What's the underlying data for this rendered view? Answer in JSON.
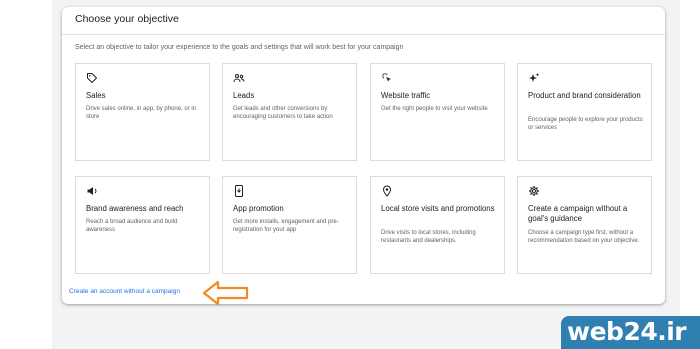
{
  "dialog": {
    "title": "Choose your objective",
    "subtitle": "Select an objective to tailor your experience to the goals and settings that will work best for your campaign"
  },
  "objectives": [
    {
      "icon": "tag-icon",
      "title": "Sales",
      "desc": "Drive sales online, in app, by phone, or in store"
    },
    {
      "icon": "people-icon",
      "title": "Leads",
      "desc": "Get leads and other conversions by encouraging customers to take action"
    },
    {
      "icon": "cursor-click-icon",
      "title": "Website traffic",
      "desc": "Get the right people to visit your website"
    },
    {
      "icon": "sparkle-icon",
      "title": "Product and brand consideration",
      "desc": "Encourage people to explore your products or services"
    },
    {
      "icon": "megaphone-icon",
      "title": "Brand awareness and reach",
      "desc": "Reach a broad audience and build awareness"
    },
    {
      "icon": "phone-icon",
      "title": "App promotion",
      "desc": "Get more installs, engagement and pre-registration for your app"
    },
    {
      "icon": "location-pin-icon",
      "title": "Local store visits and promotions",
      "desc": "Drive visits to local stores, including restaurants and dealerships."
    },
    {
      "icon": "gear-icon",
      "title": "Create a campaign without a goal's guidance",
      "desc": "Choose a campaign type first, without a recommendation based on your objective."
    }
  ],
  "footer": {
    "link": "Create an account without a campaign"
  },
  "watermark": "web24.ir",
  "colors": {
    "link": "#1a73e8",
    "arrow": "#f08a24",
    "border": "#dadce0",
    "logo_bg": "#2f7fb0"
  }
}
